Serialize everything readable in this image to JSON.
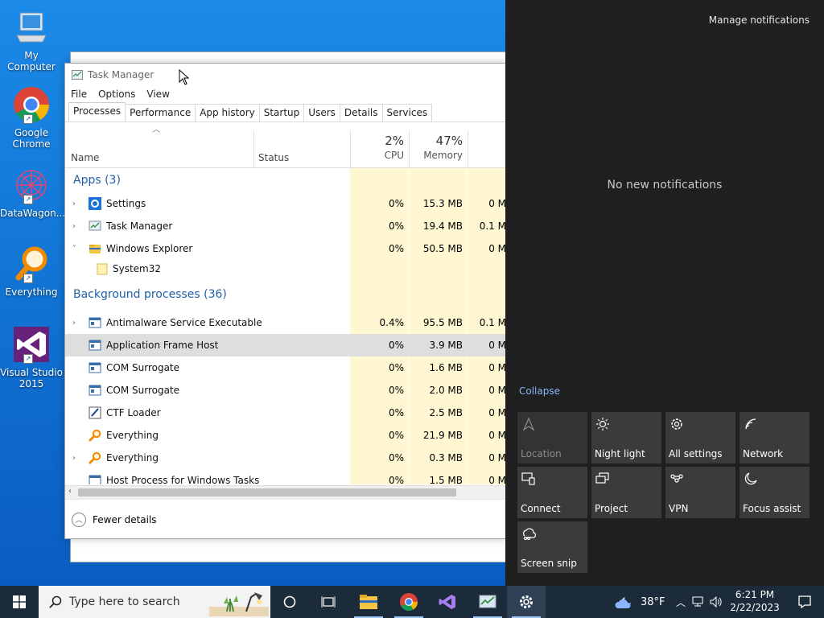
{
  "desktop": {
    "icons": [
      {
        "label": "My Computer"
      },
      {
        "label": "Google\nChrome"
      },
      {
        "label": "DataWagon..."
      },
      {
        "label": "Everything"
      },
      {
        "label": "Visual Studio\n2015"
      }
    ]
  },
  "task_manager": {
    "title": "Task Manager",
    "menu": [
      "File",
      "Options",
      "View"
    ],
    "tabs": [
      "Processes",
      "Performance",
      "App history",
      "Startup",
      "Users",
      "Details",
      "Services"
    ],
    "active_tab": "Processes",
    "columns": {
      "name": "Name",
      "status": "Status",
      "cpu_pct": "2%",
      "cpu_label": "CPU",
      "mem_pct": "47%",
      "mem_label": "Memory"
    },
    "groups": {
      "apps": "Apps (3)",
      "background": "Background processes (36)"
    },
    "apps": [
      {
        "name": "Settings",
        "cpu": "0%",
        "mem": "15.3 MB",
        "disk": "0 M",
        "expand": "›"
      },
      {
        "name": "Task Manager",
        "cpu": "0%",
        "mem": "19.4 MB",
        "disk": "0.1 M",
        "expand": "›"
      },
      {
        "name": "Windows Explorer",
        "cpu": "0%",
        "mem": "50.5 MB",
        "disk": "0 M",
        "expand": "˅"
      },
      {
        "name": "System32",
        "cpu": "",
        "mem": "",
        "disk": "",
        "expand": ""
      }
    ],
    "background": [
      {
        "name": "Antimalware Service Executable",
        "cpu": "0.4%",
        "mem": "95.5 MB",
        "disk": "0.1 M",
        "expand": "›"
      },
      {
        "name": "Application Frame Host",
        "cpu": "0%",
        "mem": "3.9 MB",
        "disk": "0 M",
        "expand": ""
      },
      {
        "name": "COM Surrogate",
        "cpu": "0%",
        "mem": "1.6 MB",
        "disk": "0 M",
        "expand": ""
      },
      {
        "name": "COM Surrogate",
        "cpu": "0%",
        "mem": "2.0 MB",
        "disk": "0 M",
        "expand": ""
      },
      {
        "name": "CTF Loader",
        "cpu": "0%",
        "mem": "2.5 MB",
        "disk": "0 M",
        "expand": ""
      },
      {
        "name": "Everything",
        "cpu": "0%",
        "mem": "21.9 MB",
        "disk": "0 M",
        "expand": ""
      },
      {
        "name": "Everything",
        "cpu": "0%",
        "mem": "0.3 MB",
        "disk": "0 M",
        "expand": "›"
      },
      {
        "name": "Host Process for Windows Tasks",
        "cpu": "0%",
        "mem": "1.5 MB",
        "disk": "0 M",
        "expand": ""
      }
    ],
    "fewer_details": "Fewer details"
  },
  "action_center": {
    "manage": "Manage notifications",
    "no_new": "No new notifications",
    "collapse": "Collapse",
    "tiles": [
      {
        "label": "Location",
        "icon": "location-icon",
        "enabled": false
      },
      {
        "label": "Night light",
        "icon": "night-light-icon",
        "enabled": true
      },
      {
        "label": "All settings",
        "icon": "gear-icon",
        "enabled": true
      },
      {
        "label": "Network",
        "icon": "network-icon",
        "enabled": true
      },
      {
        "label": "Connect",
        "icon": "connect-icon",
        "enabled": true
      },
      {
        "label": "Project",
        "icon": "project-icon",
        "enabled": true
      },
      {
        "label": "VPN",
        "icon": "vpn-icon",
        "enabled": true
      },
      {
        "label": "Focus assist",
        "icon": "moon-icon",
        "enabled": true
      },
      {
        "label": "Screen snip",
        "icon": "screen-snip-icon",
        "enabled": true
      }
    ]
  },
  "taskbar": {
    "search_placeholder": "Type here to search",
    "weather_temp": "38°F",
    "time": "6:21 PM",
    "date": "2/22/2023"
  }
}
